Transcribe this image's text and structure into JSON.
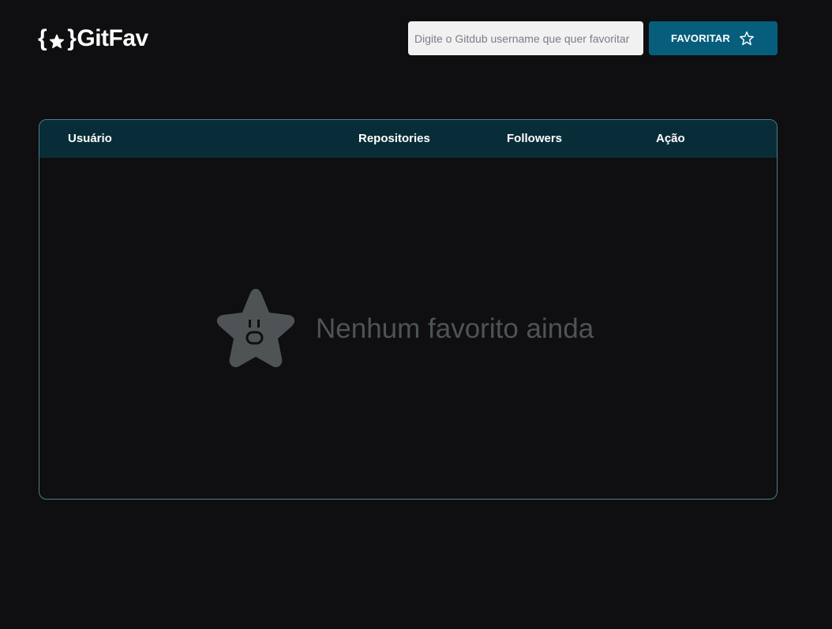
{
  "header": {
    "logo": {
      "brace_open": "{",
      "brace_close": "}",
      "icon": "star-icon",
      "text": "GitFav"
    },
    "search": {
      "placeholder": "Digite o Gitdub username que quer favoritar",
      "value": ""
    },
    "favorite_button": {
      "label": "FAVORITAR",
      "icon": "star-outline-icon"
    }
  },
  "table": {
    "columns": [
      "Usuário",
      "Repositories",
      "Followers",
      "Ação"
    ],
    "rows": [],
    "empty_state": {
      "icon": "sad-star-icon",
      "text": "Nenhum favorito ainda"
    }
  },
  "colors": {
    "background": "#0f0e10",
    "accent": "#065e7c",
    "table_header": "#092d38",
    "table_border": "#4a808c",
    "empty_text": "#4e5455"
  }
}
